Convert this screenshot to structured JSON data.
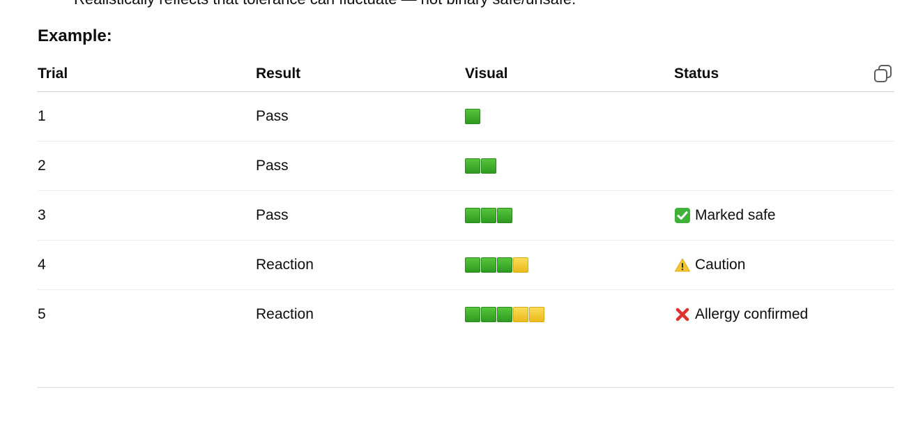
{
  "intro_fragment": "Realistically reflects that tolerance can fluctuate — not binary safe/unsafe.",
  "heading": "Example:",
  "table": {
    "headers": [
      "Trial",
      "Result",
      "Visual",
      "Status"
    ],
    "rows": [
      {
        "trial": "1",
        "result": "Pass",
        "visual": [
          "green"
        ],
        "status_icon": "",
        "status": ""
      },
      {
        "trial": "2",
        "result": "Pass",
        "visual": [
          "green",
          "green"
        ],
        "status_icon": "",
        "status": ""
      },
      {
        "trial": "3",
        "result": "Pass",
        "visual": [
          "green",
          "green",
          "green"
        ],
        "status_icon": "check-mark-icon",
        "status": "Marked safe"
      },
      {
        "trial": "4",
        "result": "Reaction",
        "visual": [
          "green",
          "green",
          "green",
          "yellow"
        ],
        "status_icon": "warning-icon",
        "status": "Caution"
      },
      {
        "trial": "5",
        "result": "Reaction",
        "visual": [
          "green",
          "green",
          "green",
          "yellow",
          "yellow"
        ],
        "status_icon": "cross-mark-icon",
        "status": "Allergy confirmed"
      }
    ]
  },
  "copy_button": {
    "icon": "copy-icon"
  },
  "colors": {
    "green_block": "#3fae2c",
    "yellow_block": "#f2c936",
    "check": "#3fb13b",
    "warning": "#f4c534",
    "cross": "#e0302e"
  }
}
